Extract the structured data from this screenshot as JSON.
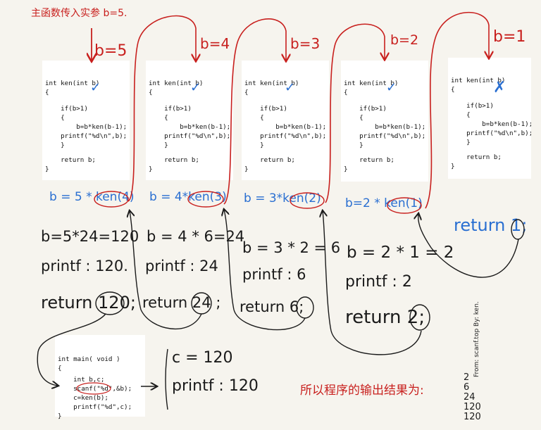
{
  "top_note": "主函数传入实参 b=5.",
  "side_note": "From: scanf.top  By: ken.",
  "calls": [
    {
      "b_label": "b=5",
      "lines": [
        "int ken(int b)",
        "{",
        "    if(b>1)",
        "    {",
        "        b=b*ken(b-1);",
        "    printf(\"%d\\n\",b);",
        "    }",
        "    return b;",
        "}"
      ],
      "check": "✓",
      "expand": "b = 5 * ken(4)",
      "result": "b=5*24=120",
      "printf": "printf : 120.",
      "ret_word": "return",
      "ret_val": "120",
      "ret_semi": ";"
    },
    {
      "b_label": "b=4",
      "lines": [
        "int ken(int b)",
        "{",
        "    if(b>1)",
        "    {",
        "        b=b*ken(b-1);",
        "    printf(\"%d\\n\",b);",
        "    }",
        "    return b;",
        "}"
      ],
      "check": "✓",
      "expand": "b = 4*ken(3)",
      "result": "b = 4 * 6=24",
      "printf": "printf : 24",
      "ret_word": "return",
      "ret_val": "24",
      "ret_semi": ";"
    },
    {
      "b_label": "b=3",
      "lines": [
        "int ken(int b)",
        "{",
        "    if(b>1)",
        "    {",
        "        b=b*ken(b-1);",
        "    printf(\"%d\\n\",b);",
        "    }",
        "    return b;",
        "}"
      ],
      "check": "✓",
      "expand": "b = 3*ken(2)",
      "result": "b = 3 * 2 = 6",
      "printf": "printf : 6",
      "ret_word": "return",
      "ret_val": "6",
      "ret_semi": ";"
    },
    {
      "b_label": "b=2",
      "lines": [
        "int ken(int b)",
        "{",
        "    if(b>1)",
        "    {",
        "        b=b*ken(b-1);",
        "    printf(\"%d\\n\",b);",
        "    }",
        "    return b;",
        "}"
      ],
      "check": "✓",
      "expand": "b=2 * ken(1)",
      "result": "b = 2 * 1 = 2",
      "printf": "printf : 2",
      "ret_word": "return",
      "ret_val": "2",
      "ret_semi": ";"
    },
    {
      "b_label": "b=1",
      "lines": [
        "int ken(int b)",
        "{",
        "    if(b>1)",
        "    {",
        "        b=b*ken(b-1);",
        "    printf(\"%d\\n\",b);",
        "    }",
        "    return b;",
        "}"
      ],
      "check": "✗",
      "ret_word": "return",
      "ret_val": "1",
      "ret_semi": ";"
    }
  ],
  "main": {
    "lines": [
      "int main( void )",
      "{",
      "    int b,c;",
      "    scanf(\"%d\",&b);",
      "    c=ken(b);",
      "    printf(\"%d\",c);",
      "}"
    ],
    "c_value": "c = 120",
    "printf_value": "printf : 120"
  },
  "conclusion": "所以程序的输出结果为:",
  "outputs": [
    "2",
    "6",
    "24",
    "120",
    "120"
  ],
  "colors": {
    "ink": "#1a1a1a",
    "red": "#c8201e",
    "blue": "#2a6fd1",
    "paper": "#f6f4ee"
  }
}
